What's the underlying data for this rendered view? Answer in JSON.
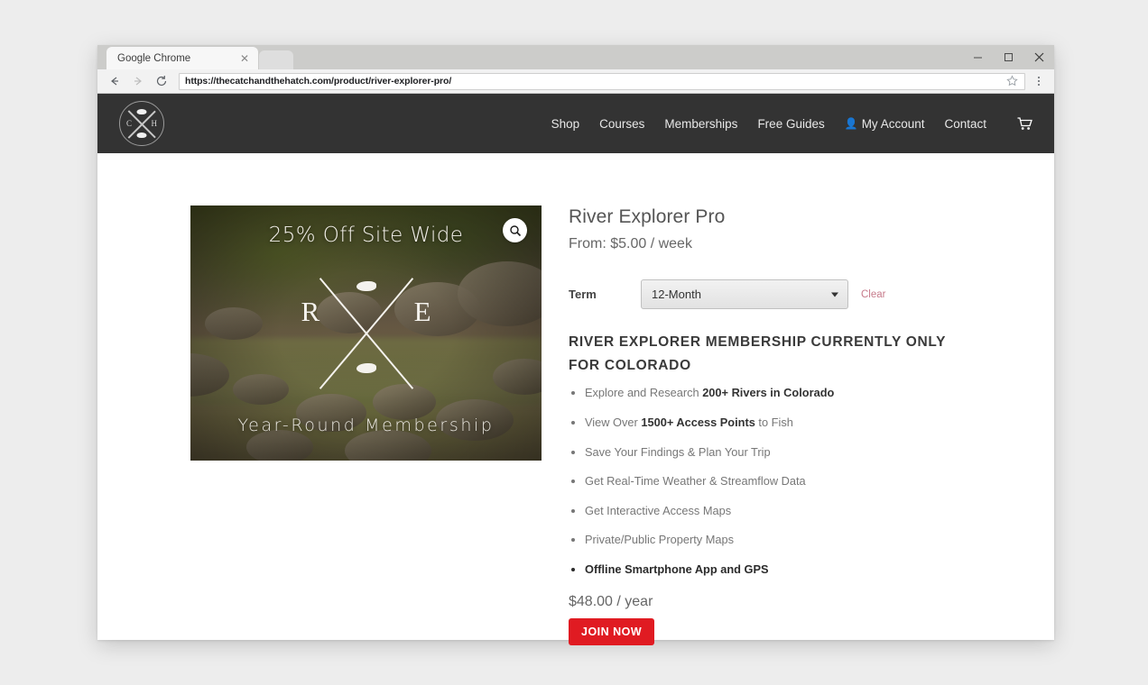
{
  "browser": {
    "tab_title": "Google Chrome",
    "tab_close_icon": "close-icon",
    "back_icon": "arrow-left-icon",
    "forward_icon": "arrow-right-icon",
    "reload_icon": "reload-icon",
    "url": "https://thecatchandthehatch.com/product/river-explorer-pro/",
    "star_icon": "star-icon",
    "menu_icon": "three-dots-menu-icon",
    "minimize_icon": "minimize-icon",
    "maximize_icon": "maximize-icon",
    "close_window_icon": "close-window-icon"
  },
  "site_header": {
    "logo": {
      "letter_left": "C",
      "letter_right": "H",
      "name": "catch-and-hatch-logo"
    },
    "bg_color": "#333333",
    "nav": [
      {
        "label": "Shop",
        "name": "nav-shop"
      },
      {
        "label": "Courses",
        "name": "nav-courses"
      },
      {
        "label": "Memberships",
        "name": "nav-memberships"
      },
      {
        "label": "Free Guides",
        "name": "nav-free-guides"
      },
      {
        "label": "My Account",
        "name": "nav-my-account",
        "icon": "person-icon"
      },
      {
        "label": "Contact",
        "name": "nav-contact"
      }
    ],
    "cart_icon": "shopping-cart-icon"
  },
  "product": {
    "image": {
      "overlay_top": "25% Off Site Wide",
      "overlay_bottom": "Year-Round Membership",
      "mark_left": "R",
      "mark_right": "E",
      "zoom_icon": "magnifier-icon"
    },
    "title": "River Explorer Pro",
    "price_from": "From: $5.00 / week",
    "variation": {
      "label": "Term",
      "selected": "12-Month",
      "options": [
        "12-Month"
      ],
      "clear_label": "Clear"
    },
    "feature_heading": "RIVER EXPLORER MEMBERSHIP CURRENTLY ONLY FOR COLORADO",
    "features": [
      {
        "prefix": "Explore and Research ",
        "strong": "200+ Rivers in Colorado",
        "suffix": "",
        "bold": false
      },
      {
        "prefix": "View Over ",
        "strong": "1500+ Access Points",
        "suffix": " to Fish",
        "bold": false
      },
      {
        "prefix": "Save Your Findings & Plan Your Trip",
        "strong": "",
        "suffix": "",
        "bold": false
      },
      {
        "prefix": "Get Real-Time Weather & Streamflow Data",
        "strong": "",
        "suffix": "",
        "bold": false
      },
      {
        "prefix": "Get Interactive Access Maps",
        "strong": "",
        "suffix": "",
        "bold": false
      },
      {
        "prefix": "Private/Public Property Maps",
        "strong": "",
        "suffix": "",
        "bold": false
      },
      {
        "prefix": "Offline Smartphone App and GPS",
        "strong": "",
        "suffix": "",
        "bold": true
      }
    ],
    "final_price": "$48.00 / year",
    "cta_label": "JOIN NOW",
    "cta_color": "#e01b22"
  }
}
